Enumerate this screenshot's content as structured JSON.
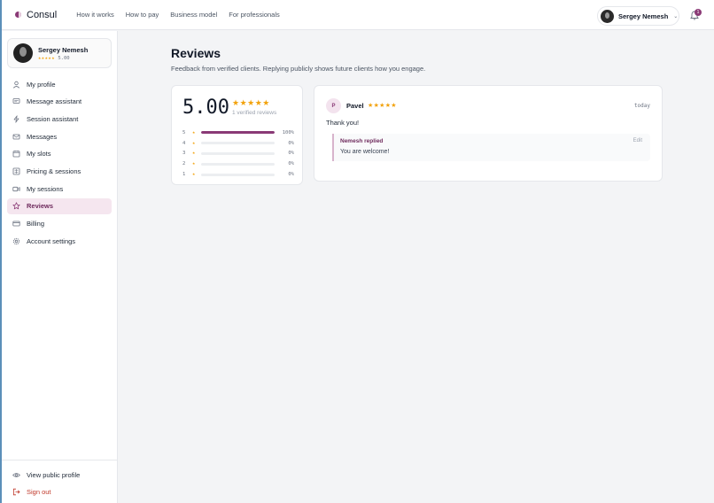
{
  "header": {
    "brand": "Consul",
    "nav": [
      "How it works",
      "How to pay",
      "Business model",
      "For professionals"
    ],
    "user_name": "Sergey Nemesh",
    "notification_count": "1"
  },
  "sidebar": {
    "profile": {
      "name": "Sergey Nemesh",
      "stars": "★★★★★",
      "rating": "5.00"
    },
    "items": [
      {
        "label": "My profile",
        "icon": "user-icon"
      },
      {
        "label": "Message assistant",
        "icon": "message-icon"
      },
      {
        "label": "Session assistant",
        "icon": "bolt-icon"
      },
      {
        "label": "Messages",
        "icon": "mail-icon"
      },
      {
        "label": "My slots",
        "icon": "calendar-icon"
      },
      {
        "label": "Pricing & sessions",
        "icon": "pricing-icon"
      },
      {
        "label": "My sessions",
        "icon": "video-icon"
      },
      {
        "label": "Reviews",
        "icon": "star-icon",
        "active": true
      },
      {
        "label": "Billing",
        "icon": "card-icon"
      },
      {
        "label": "Account settings",
        "icon": "gear-icon"
      }
    ],
    "bottom": {
      "view_public_profile": "View public profile",
      "sign_out": "Sign out"
    }
  },
  "main": {
    "title": "Reviews",
    "subtitle": "Feedback from verified clients. Replying publicly shows future clients how you engage.",
    "summary": {
      "score": "5.00",
      "stars": "★★★★★",
      "count_label": "1 verified reviews",
      "distribution": [
        {
          "stars": "5",
          "percent": 100,
          "label": "100%"
        },
        {
          "stars": "4",
          "percent": 0,
          "label": "0%"
        },
        {
          "stars": "3",
          "percent": 0,
          "label": "0%"
        },
        {
          "stars": "2",
          "percent": 0,
          "label": "0%"
        },
        {
          "stars": "1",
          "percent": 0,
          "label": "0%"
        }
      ]
    },
    "review": {
      "initial": "P",
      "author": "Pavel",
      "stars": "★★★★★",
      "date": "today",
      "text": "Thank you!",
      "reply": {
        "author_label": "Nemesh replied",
        "edit_label": "Edit",
        "text": "You are welcome!"
      }
    }
  },
  "colors": {
    "accent": "#8a3a76",
    "star": "#f2a20c",
    "active_bg": "#f5e6ef",
    "danger": "#c0392b"
  }
}
